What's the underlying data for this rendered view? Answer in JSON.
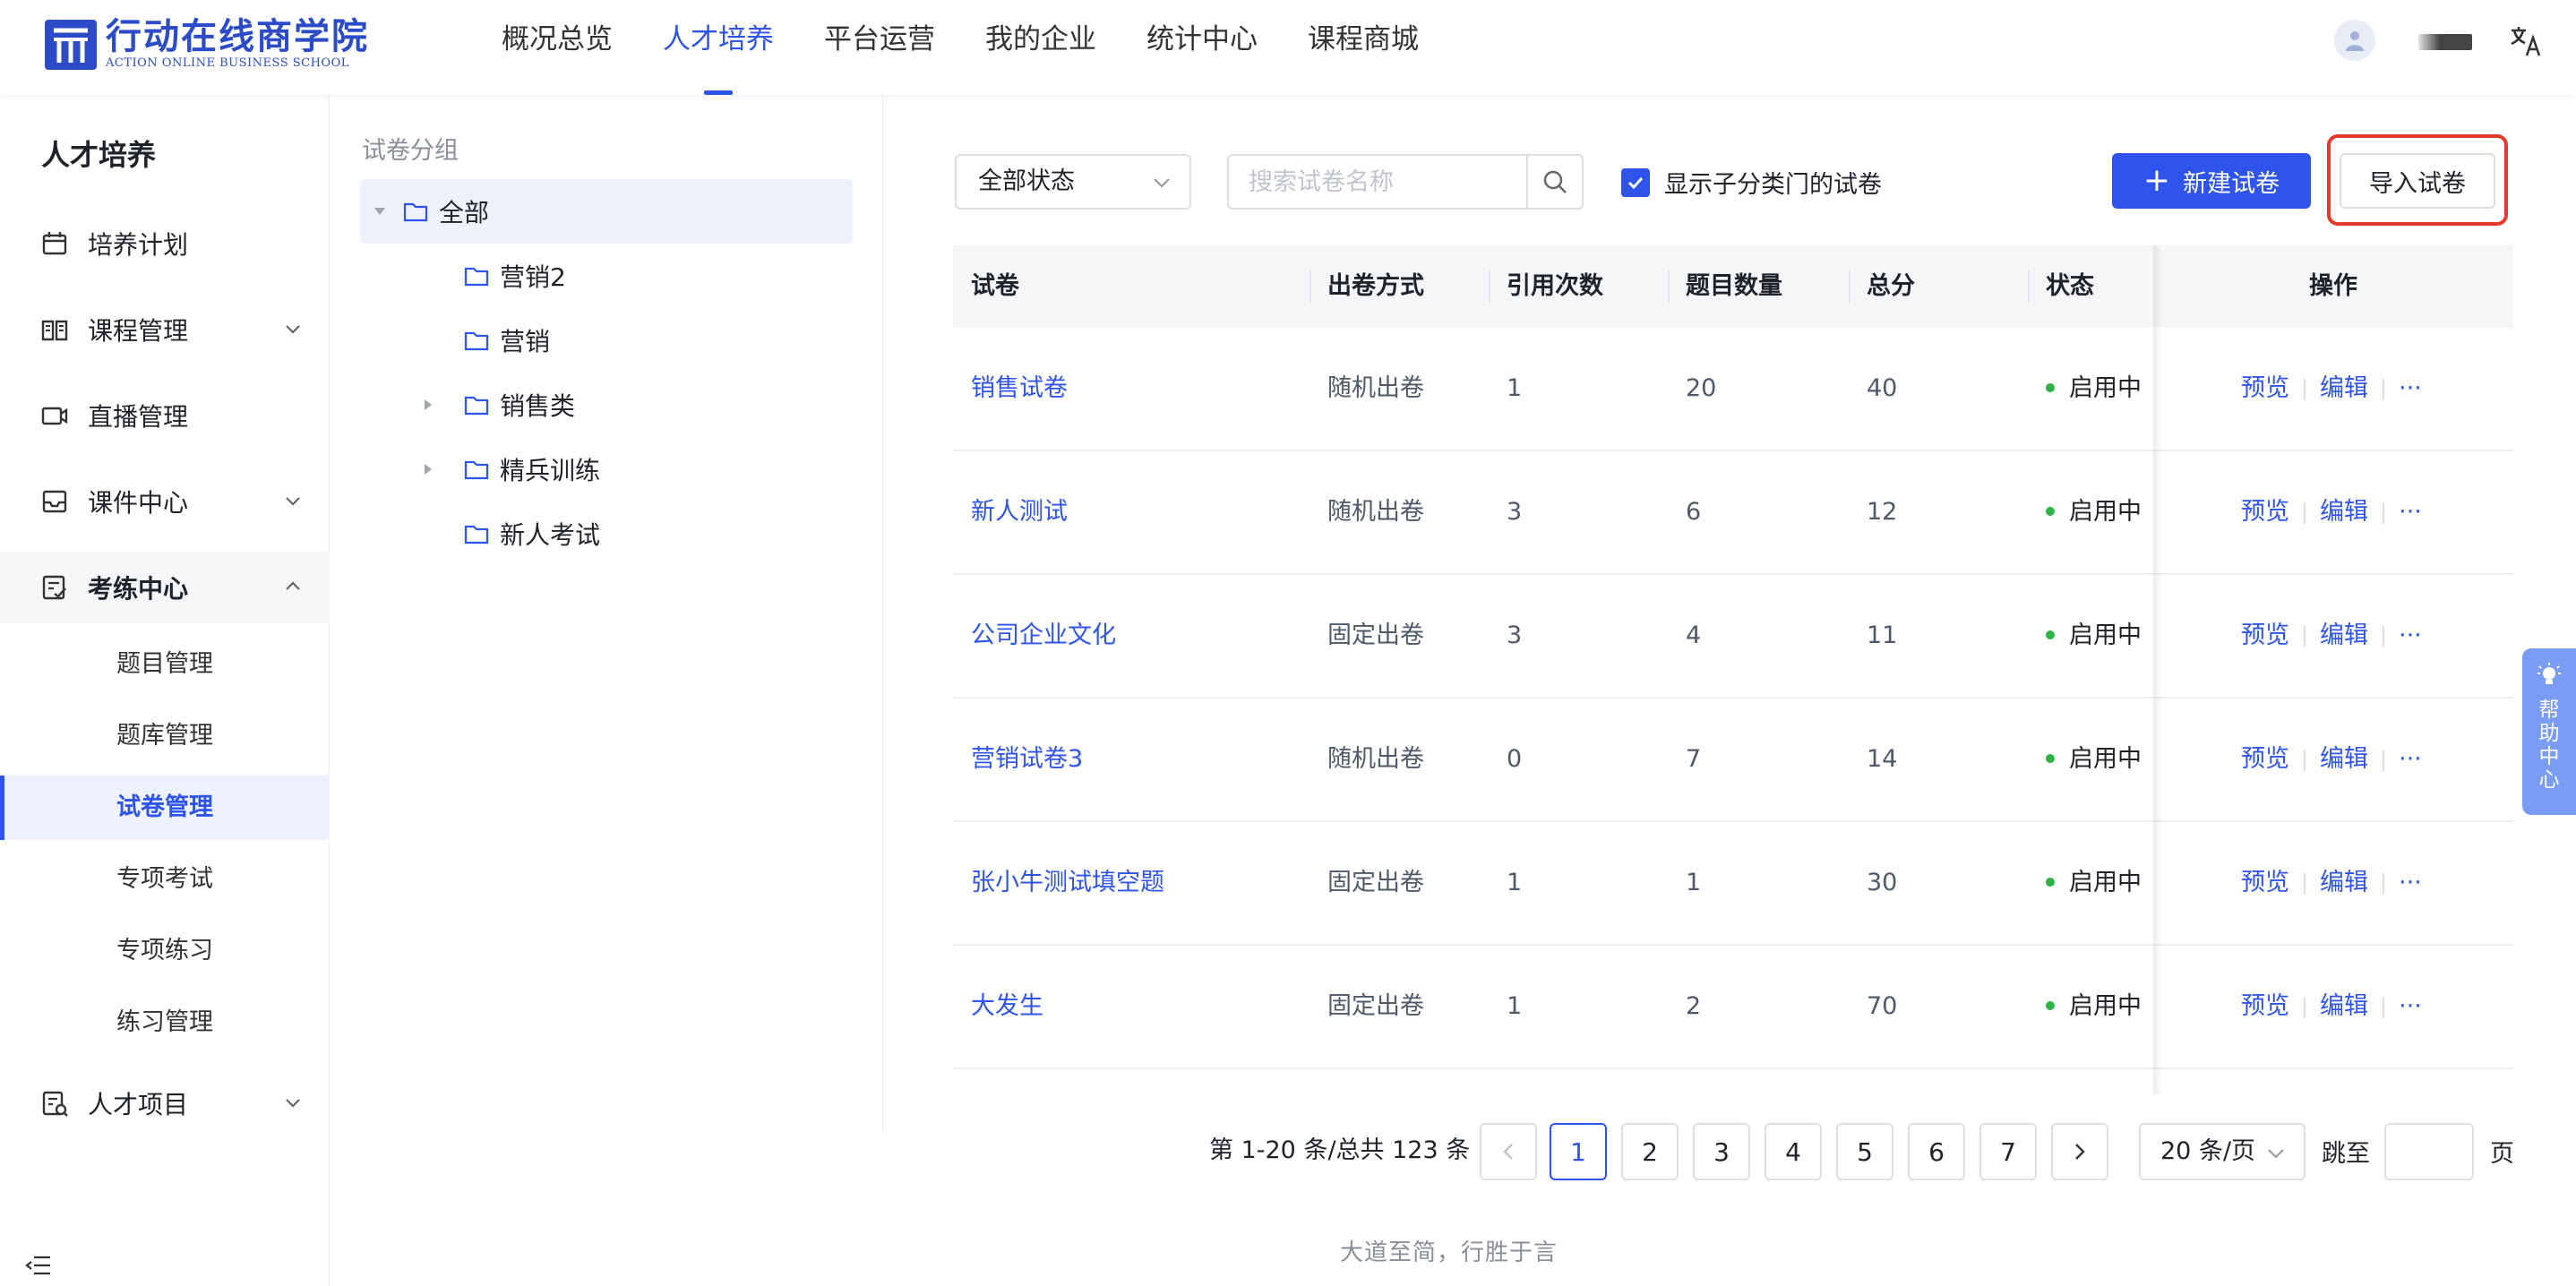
{
  "brand": {
    "name_cn": "行动在线商学院",
    "name_en": "ACTION ONLINE BUSINESS SCHOOL",
    "color": "#2b4bc8"
  },
  "topnav": [
    {
      "label": "概况总览",
      "active": false
    },
    {
      "label": "人才培养",
      "active": true
    },
    {
      "label": "平台运营",
      "active": false
    },
    {
      "label": "我的企业",
      "active": false
    },
    {
      "label": "统计中心",
      "active": false
    },
    {
      "label": "课程商城",
      "active": false
    }
  ],
  "sidebar": {
    "title": "人才培养",
    "items": [
      {
        "label": "培养计划",
        "icon": "calendar-icon"
      },
      {
        "label": "课程管理",
        "icon": "book-icon",
        "expandable": true
      },
      {
        "label": "直播管理",
        "icon": "video-icon"
      },
      {
        "label": "课件中心",
        "icon": "inbox-icon",
        "expandable": true
      },
      {
        "label": "考练中心",
        "icon": "exam-icon",
        "expandable": true,
        "open": true
      },
      {
        "label": "人才项目",
        "icon": "project-icon",
        "expandable": true
      }
    ],
    "sub_items": [
      {
        "label": "题目管理",
        "active": false
      },
      {
        "label": "题库管理",
        "active": false
      },
      {
        "label": "试卷管理",
        "active": true
      },
      {
        "label": "专项考试",
        "active": false
      },
      {
        "label": "专项练习",
        "active": false
      },
      {
        "label": "练习管理",
        "active": false
      }
    ]
  },
  "tree": {
    "title": "试卷分组",
    "nodes": [
      {
        "label": "全部",
        "level": 0,
        "expanded": true,
        "selected": true
      },
      {
        "label": "营销2",
        "level": 1,
        "has_children": false
      },
      {
        "label": "营销",
        "level": 1,
        "has_children": false
      },
      {
        "label": "销售类",
        "level": 1,
        "has_children": true
      },
      {
        "label": "精兵训练",
        "level": 1,
        "has_children": true
      },
      {
        "label": "新人考试",
        "level": 1,
        "has_children": false
      }
    ]
  },
  "toolbar": {
    "status_select": "全部状态",
    "search_placeholder": "搜索试卷名称",
    "checkbox_label": "显示子分类门的试卷",
    "checkbox_checked": true,
    "new_button": "新建试卷",
    "import_button": "导入试卷"
  },
  "table": {
    "columns": [
      "试卷",
      "出卷方式",
      "引用次数",
      "题目数量",
      "总分",
      "状态",
      "操作"
    ],
    "rows": [
      {
        "name": "销售试卷",
        "mode": "随机出卷",
        "refs": "1",
        "count": "20",
        "score": "40",
        "status": "启用中"
      },
      {
        "name": "新人测试",
        "mode": "随机出卷",
        "refs": "3",
        "count": "6",
        "score": "12",
        "status": "启用中"
      },
      {
        "name": "公司企业文化",
        "mode": "固定出卷",
        "refs": "3",
        "count": "4",
        "score": "11",
        "status": "启用中"
      },
      {
        "name": "营销试卷3",
        "mode": "随机出卷",
        "refs": "0",
        "count": "7",
        "score": "14",
        "status": "启用中"
      },
      {
        "name": "张小牛测试填空题",
        "mode": "固定出卷",
        "refs": "1",
        "count": "1",
        "score": "30",
        "status": "启用中"
      },
      {
        "name": "大发生",
        "mode": "固定出卷",
        "refs": "1",
        "count": "2",
        "score": "70",
        "status": "启用中"
      }
    ],
    "actions": {
      "preview": "预览",
      "edit": "编辑",
      "more": "···"
    }
  },
  "pagination": {
    "total_text": "第 1-20 条/总共 123 条",
    "prev": "<",
    "next": ">",
    "pages": [
      "1",
      "2",
      "3",
      "4",
      "5",
      "6",
      "7"
    ],
    "current": "1",
    "page_size": "20 条/页",
    "jump_label": "跳至",
    "jump_suffix": "页"
  },
  "footer": "大道至简，行胜于言",
  "help": "帮助中心",
  "colors": {
    "primary": "#2f54eb",
    "status_green": "#2fb344",
    "highlight_red": "#e23a2b"
  }
}
